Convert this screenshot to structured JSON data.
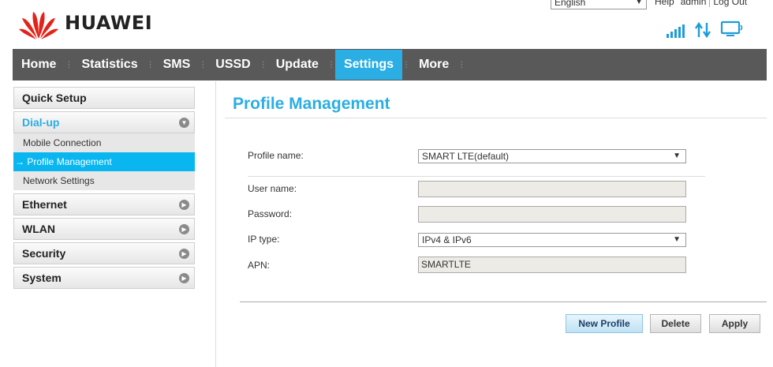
{
  "brand": {
    "name": "HUAWEI",
    "logo_color": "#e2231a"
  },
  "topbar": {
    "language": "English",
    "links": [
      "Help",
      "admin",
      "Log Out"
    ]
  },
  "status_icons": [
    "signal-icon",
    "data-transfer-icon",
    "pc-connection-icon"
  ],
  "colors": {
    "accent": "#2aaee3",
    "nav_bg": "#595959",
    "active_sub": "#09b6f0"
  },
  "nav": {
    "items": [
      "Home",
      "Statistics",
      "SMS",
      "USSD",
      "Update",
      "Settings",
      "More"
    ],
    "active": "Settings"
  },
  "sidebar": {
    "quick_setup": "Quick Setup",
    "dialup": "Dial-up",
    "dialup_items": [
      "Mobile Connection",
      "Profile Management",
      "Network Settings"
    ],
    "active_item_prefix": "→",
    "sections": [
      "Ethernet",
      "WLAN",
      "Security",
      "System"
    ]
  },
  "main": {
    "title": "Profile Management",
    "profile_name_label": "Profile name:",
    "profile_name_value": "SMART LTE(default)",
    "username_label": "User name:",
    "username_value": "",
    "password_label": "Password:",
    "password_value": "",
    "iptype_label": "IP type:",
    "iptype_value": "IPv4 & IPv6",
    "apn_label": "APN:",
    "apn_value": "SMARTLTE"
  },
  "buttons": {
    "new_profile": "New Profile",
    "delete": "Delete",
    "apply": "Apply"
  }
}
